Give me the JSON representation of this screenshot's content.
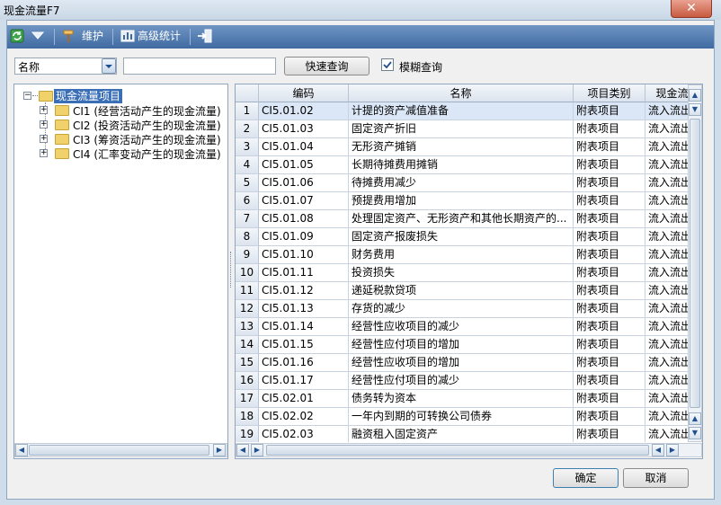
{
  "window": {
    "title": "现金流量F7",
    "close_label": "✕"
  },
  "toolbar": {
    "maintain_label": "维护",
    "advanced_stats_label": "高级统计"
  },
  "search": {
    "field_value": "名称",
    "input_value": "",
    "quick_query_label": "快速查询",
    "fuzzy_query_label": "模糊查询",
    "fuzzy_checked": true
  },
  "tree": {
    "root": "现金流量项目",
    "children": [
      "CI1 (经营活动产生的现金流量)",
      "CI2 (投资活动产生的现金流量)",
      "CI3 (筹资活动产生的现金流量)",
      "CI4 (汇率变动产生的现金流量)"
    ]
  },
  "table": {
    "columns": [
      "编码",
      "名称",
      "项目类别",
      "现金流"
    ],
    "rows": [
      [
        "1",
        "CI5.01.02",
        "计提的资产减值准备",
        "附表项目",
        "流入流出"
      ],
      [
        "2",
        "CI5.01.03",
        "固定资产折旧",
        "附表项目",
        "流入流出"
      ],
      [
        "3",
        "CI5.01.04",
        "无形资产摊销",
        "附表项目",
        "流入流出"
      ],
      [
        "4",
        "CI5.01.05",
        "长期待摊费用摊销",
        "附表项目",
        "流入流出"
      ],
      [
        "5",
        "CI5.01.06",
        "待摊费用减少",
        "附表项目",
        "流入流出"
      ],
      [
        "6",
        "CI5.01.07",
        "预提费用增加",
        "附表项目",
        "流入流出"
      ],
      [
        "7",
        "CI5.01.08",
        "处理固定资产、无形资产和其他长期资产的...",
        "附表项目",
        "流入流出"
      ],
      [
        "8",
        "CI5.01.09",
        "固定资产报废损失",
        "附表项目",
        "流入流出"
      ],
      [
        "9",
        "CI5.01.10",
        "财务费用",
        "附表项目",
        "流入流出"
      ],
      [
        "10",
        "CI5.01.11",
        "投资损失",
        "附表项目",
        "流入流出"
      ],
      [
        "11",
        "CI5.01.12",
        "递延税款贷项",
        "附表项目",
        "流入流出"
      ],
      [
        "12",
        "CI5.01.13",
        "存货的减少",
        "附表项目",
        "流入流出"
      ],
      [
        "13",
        "CI5.01.14",
        "经营性应收项目的减少",
        "附表项目",
        "流入流出"
      ],
      [
        "14",
        "CI5.01.15",
        "经营性应付项目的增加",
        "附表项目",
        "流入流出"
      ],
      [
        "15",
        "CI5.01.16",
        "经营性应收项目的增加",
        "附表项目",
        "流入流出"
      ],
      [
        "16",
        "CI5.01.17",
        "经营性应付项目的减少",
        "附表项目",
        "流入流出"
      ],
      [
        "17",
        "CI5.02.01",
        "债务转为资本",
        "附表项目",
        "流入流出"
      ],
      [
        "18",
        "CI5.02.02",
        "一年内到期的可转换公司债券",
        "附表项目",
        "流入流出"
      ],
      [
        "19",
        "CI5.02.03",
        "融资租入固定资产",
        "附表项目",
        "流入流出"
      ]
    ]
  },
  "footer": {
    "ok_label": "确定",
    "cancel_label": "取消"
  },
  "colors": {
    "toolbar": "#4f78ad",
    "selected_tree": "#3a6fb7",
    "accent": "#2a5a9a"
  }
}
